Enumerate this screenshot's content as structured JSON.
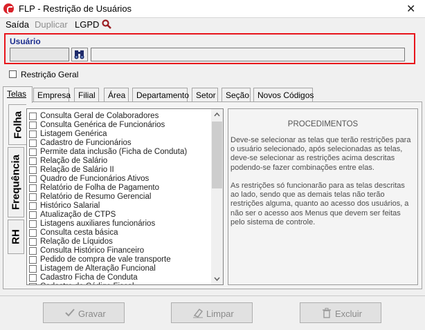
{
  "window": {
    "title": "FLP - Restrição de Usuários"
  },
  "menu": {
    "saida": "Saída",
    "duplicar": "Duplicar",
    "lgpd": "LGPD"
  },
  "usuario": {
    "legend": "Usuário",
    "code": "",
    "name": ""
  },
  "restricao_geral": {
    "label": "Restrição Geral",
    "checked": false
  },
  "tabs": [
    "Telas",
    "Empresa",
    "Filial",
    "Área",
    "Departamento",
    "Setor",
    "Seção",
    "Novos Códigos"
  ],
  "side_tabs": [
    "Folha",
    "Frequência",
    "RH"
  ],
  "screens": [
    "Consulta Geral de Colaboradores",
    "Consulta Genérica de Funcionários",
    "Listagem Genérica",
    "Cadastro de Funcionários",
    "Permite data inclusão (Ficha de Conduta)",
    "Relação de Salário",
    "Relação de Salário II",
    "Quadro de Funcionários Ativos",
    "Relatório de Folha de Pagamento",
    "Relatório de Resumo Gerencial",
    "Histórico Salarial",
    "Atualização de CTPS",
    "Listagens auxiliares funcionários",
    "Consulta cesta básica",
    "Relação de Líquidos",
    "Consulta Histórico Financeiro",
    "Pedido de compra de vale transporte",
    "Listagem de Alteração Funcional",
    "Cadastro Ficha de Conduta",
    "Cadastro de Código Fiscal"
  ],
  "procedures": {
    "title": "PROCEDIMENTOS",
    "p1": "Deve-se selecionar as telas que terão restrições para o usuário selecionado, após selecionadas as telas, deve-se selecionar as restrições acima descritas podendo-se fazer combinações entre elas.",
    "p2": "As restrições só funcionarão para as telas descritas ao lado, sendo que as demais telas não terão restrições alguma, quanto ao acesso dos usuários, a não ser o acesso aos Menus que devem ser feitas pelo sistema de controle."
  },
  "buttons": {
    "gravar": "Gravar",
    "limpar": "Limpar",
    "excluir": "Excluir"
  },
  "colors": {
    "accent_red": "#e8141b",
    "legend_blue": "#1d2e8f"
  },
  "icons": [
    "app-icon",
    "close-icon",
    "search-icon",
    "binoculars-icon",
    "check-icon",
    "eraser-icon",
    "trash-icon"
  ]
}
